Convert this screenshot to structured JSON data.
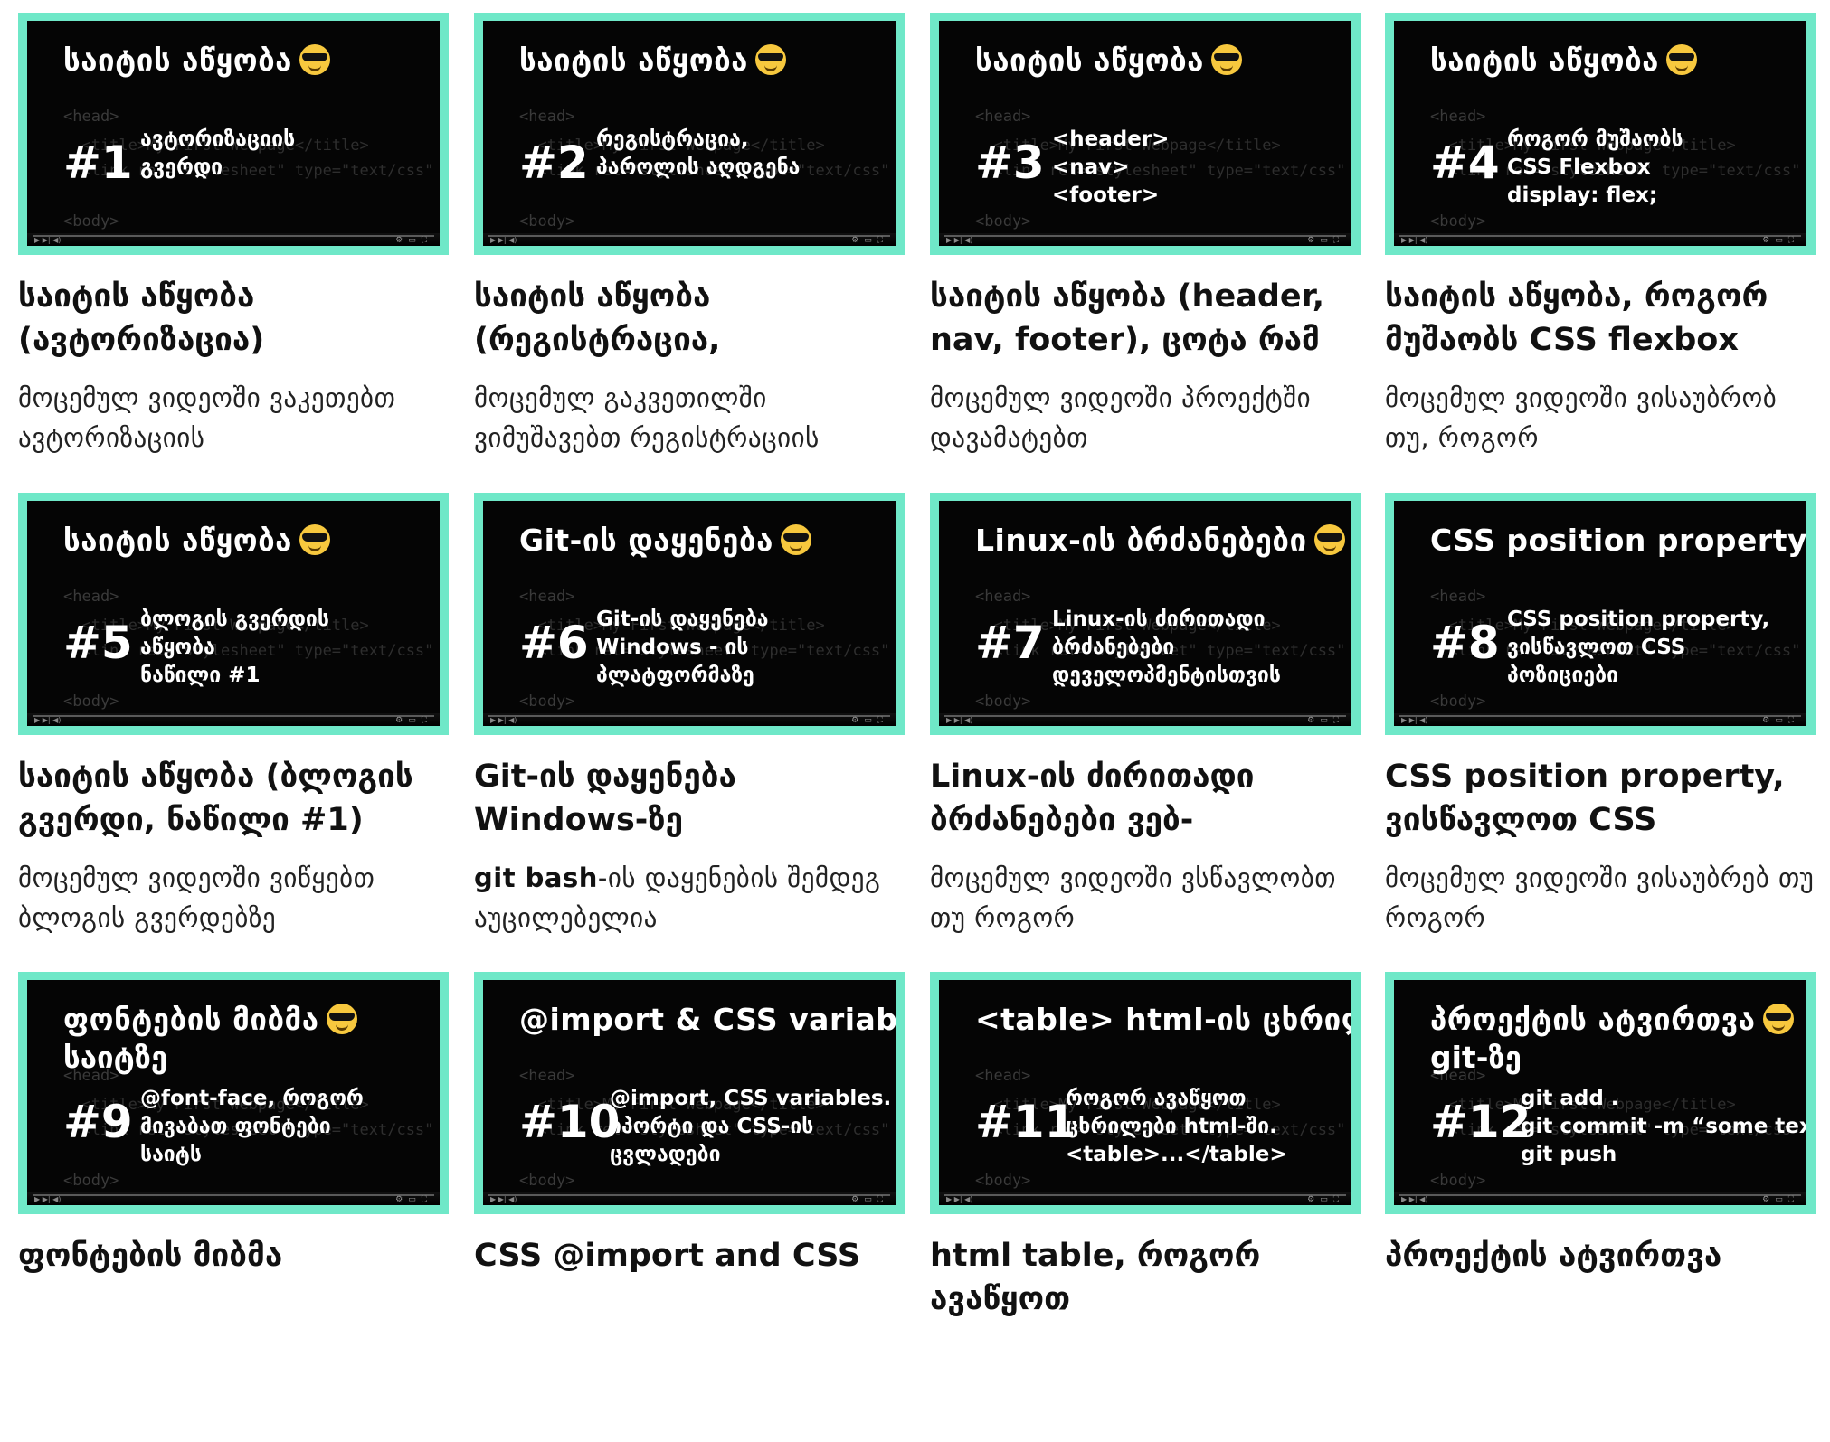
{
  "cards": [
    {
      "thumb_title": "საიტის აწყობა",
      "thumb_title2": "",
      "number": "#1",
      "thumb_desc": "ავტორიზაციის\nგვერდი",
      "title": "საიტის აწყობა (ავტორიზაცია)",
      "excerpt": "მოცემულ ვიდეოში ვაკეთებთ ავტორიზაციის",
      "excerpt_bold": ""
    },
    {
      "thumb_title": "საიტის აწყობა",
      "thumb_title2": "",
      "number": "#2",
      "thumb_desc": "რეგისტრაცია,\nპაროლის აღდგენა",
      "title": "საიტის აწყობა (რეგისტრაცია,",
      "excerpt": "მოცემულ გაკვეთილში ვიმუშავებთ რეგისტრაციის",
      "excerpt_bold": ""
    },
    {
      "thumb_title": "საიტის აწყობა",
      "thumb_title2": "",
      "number": "#3",
      "thumb_desc": "<header>\n<nav>\n<footer>",
      "title": "საიტის აწყობა (header, nav, footer), ცოტა რამ",
      "excerpt": "მოცემულ ვიდეოში პროექტში დავამატებთ",
      "excerpt_bold": ""
    },
    {
      "thumb_title": "საიტის აწყობა",
      "thumb_title2": "",
      "number": "#4",
      "thumb_desc": "როგორ მუშაობს\nCSS Flexbox\ndisplay: flex;",
      "title": "საიტის აწყობა, როგორ მუშაობს CSS flexbox",
      "excerpt": "მოცემულ ვიდეოში ვისაუბრობ თუ, როგორ",
      "excerpt_bold": ""
    },
    {
      "thumb_title": "საიტის აწყობა",
      "thumb_title2": "",
      "number": "#5",
      "thumb_desc": "ბლოგის გვერდის\nაწყობა\nნაწილი #1",
      "title": "საიტის აწყობა (ბლოგის გვერდი, ნაწილი #1)",
      "excerpt": "მოცემულ ვიდეოში ვიწყებთ ბლოგის გვერდებზე",
      "excerpt_bold": ""
    },
    {
      "thumb_title": "Git-ის დაყენება",
      "thumb_title2": "",
      "number": "#6",
      "thumb_desc": "Git-ის დაყენება\nWindows - ის\nპლატფორმაზე",
      "title": "Git-ის დაყენება Windows-ზე",
      "excerpt": "-ის დაყენების შემდეგ აუცილებელია",
      "excerpt_bold": "git bash"
    },
    {
      "thumb_title": "Linux-ის ბრძანებები",
      "thumb_title2": "",
      "number": "#7",
      "thumb_desc": "Linux-ის ძირითადი\nბრძანებები\nდეველოპმენტისთვის",
      "title": "Linux-ის ძირითადი ბრძანებები ვებ-",
      "excerpt": "მოცემულ ვიდეოში ვსწავლობთ თუ როგორ",
      "excerpt_bold": ""
    },
    {
      "thumb_title": "CSS position property",
      "thumb_title2": "",
      "number": "#8",
      "thumb_desc": "CSS position property,\nვისწავლოთ CSS\nპოზიციები",
      "title": "CSS position property, ვისწავლოთ CSS",
      "excerpt": "მოცემულ ვიდეოში ვისაუბრებ თუ როგორ",
      "excerpt_bold": ""
    },
    {
      "thumb_title": "ფონტების მიბმა",
      "thumb_title2": "საიტზე",
      "number": "#9",
      "thumb_desc": "@font-face, როგორ\nმივაბათ ფონტები\nსაიტს",
      "title": "ფონტების მიბმა",
      "excerpt": "",
      "excerpt_bold": ""
    },
    {
      "thumb_title": "@import & CSS variables",
      "thumb_title2": "",
      "number": "#10",
      "thumb_desc": "@import, CSS variables.\nიპორტი და CSS-ის\nცვლადები",
      "title": "CSS @import and CSS",
      "excerpt": "",
      "excerpt_bold": ""
    },
    {
      "thumb_title": "<table> html-ის ცხრილები",
      "thumb_title2": "",
      "number": "#11",
      "thumb_desc": "როგორ ავაწყოთ\nცხრილები html-ში.\n<table>...</table>",
      "title": "html table, როგორ ავაწყოთ",
      "excerpt": "",
      "excerpt_bold": ""
    },
    {
      "thumb_title": "პროექტის ატვირთვა",
      "thumb_title2": "git-ზე",
      "number": "#12",
      "thumb_desc": "git add .\ngit commit -m “some text”\ngit push",
      "title": "პროექტის ატვირთვა",
      "excerpt": "",
      "excerpt_bold": ""
    }
  ],
  "icons": {
    "emoji": "sunglasses-emoji-icon"
  }
}
